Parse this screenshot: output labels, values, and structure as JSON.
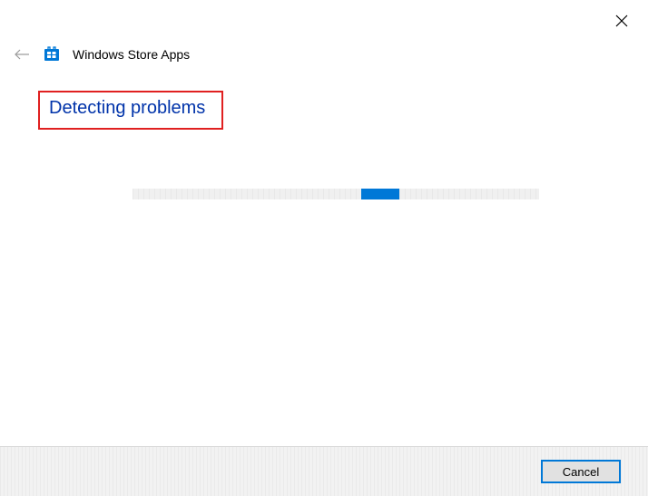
{
  "header": {
    "app_title": "Windows Store Apps"
  },
  "status": {
    "message": "Detecting problems"
  },
  "footer": {
    "cancel_label": "Cancel"
  },
  "colors": {
    "accent": "#0078d7",
    "highlight_border": "#e02020",
    "status_text": "#0033aa"
  }
}
